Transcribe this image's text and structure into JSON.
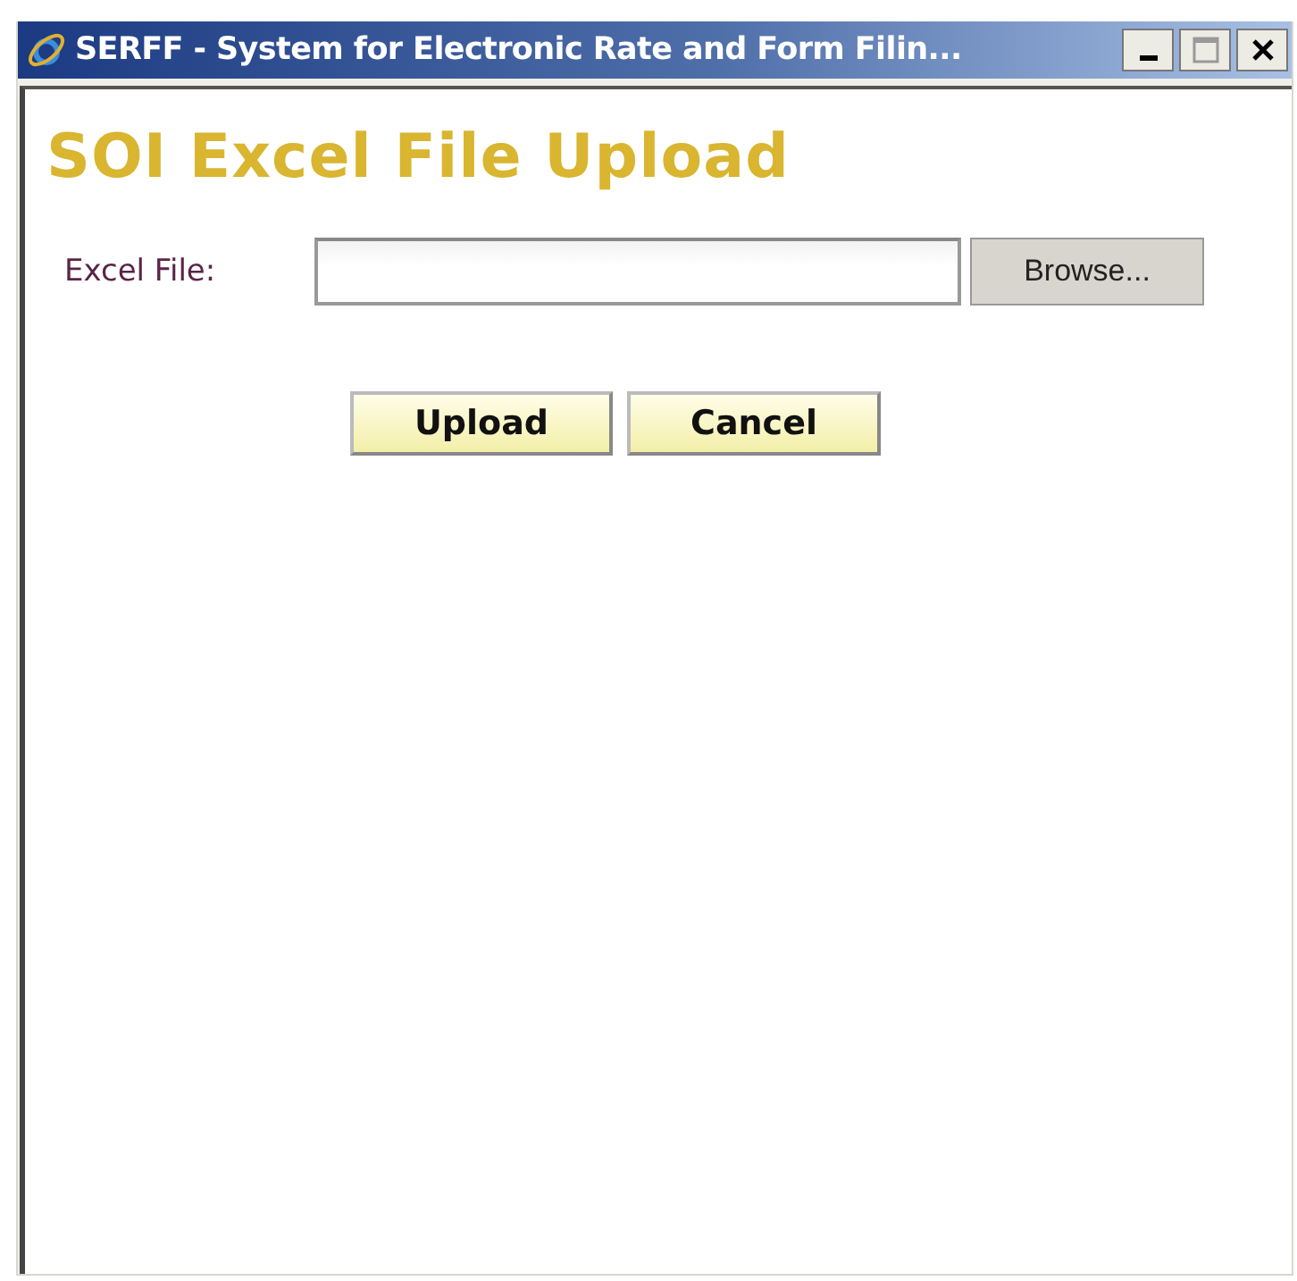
{
  "window": {
    "title": "SERFF - System for Electronic Rate and Form Filin..."
  },
  "heading": "SOI Excel File Upload",
  "file_field": {
    "label": "Excel File:",
    "browse": "Browse..."
  },
  "buttons": [
    "Upload",
    "Cancel"
  ]
}
